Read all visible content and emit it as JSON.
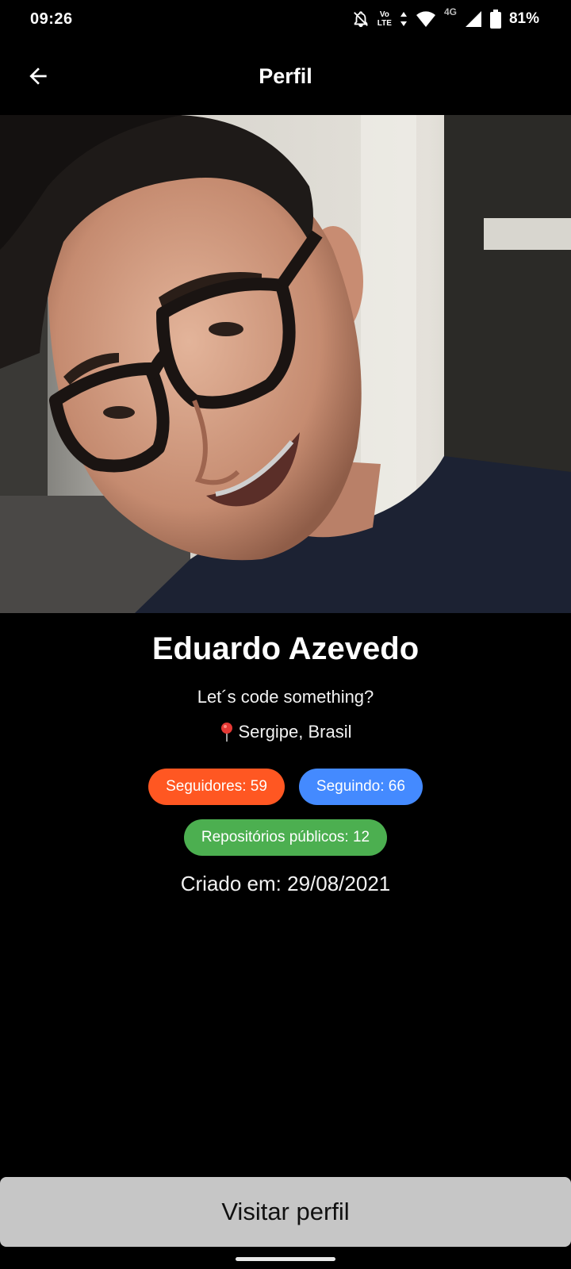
{
  "status_bar": {
    "time": "09:26",
    "volte_top": "Vo",
    "volte_bottom": "LTE",
    "network": "4G",
    "battery": "81%"
  },
  "app_bar": {
    "title": "Perfil",
    "back_icon": "arrow-left-icon"
  },
  "profile": {
    "name": "Eduardo Azevedo",
    "bio": "Let´s code something?",
    "location": "Sergipe, Brasil",
    "location_icon": "pin-icon",
    "followers": "Seguidores: 59",
    "following": "Seguindo: 66",
    "public_repos": "Repositórios públicos: 12",
    "created": "Criado em: 29/08/2021"
  },
  "colors": {
    "followers_chip": "#FF5722",
    "following_chip": "#448AFF",
    "repos_chip": "#4CAF50",
    "visit_button": "#C6C6C6"
  },
  "actions": {
    "visit_profile": "Visitar perfil"
  }
}
